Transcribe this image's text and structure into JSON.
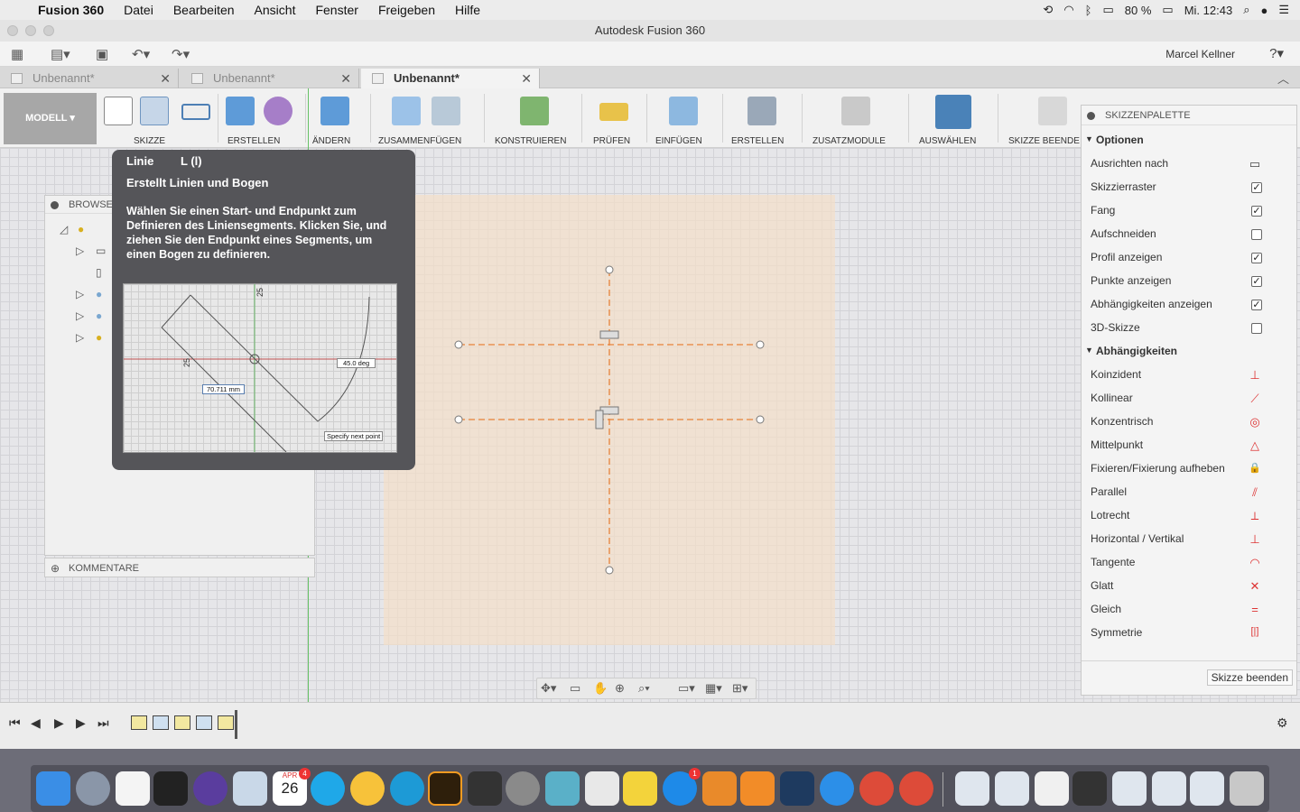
{
  "menubar": {
    "app_name": "Fusion 360",
    "items": [
      "Datei",
      "Bearbeiten",
      "Ansicht",
      "Fenster",
      "Freigeben",
      "Hilfe"
    ],
    "battery": "80 %",
    "clock": "Mi. 12:43"
  },
  "window": {
    "title": "Autodesk Fusion 360",
    "user": "Marcel Kellner"
  },
  "tabs": [
    {
      "label": "Unbenannt*",
      "active": false
    },
    {
      "label": "Unbenannt*",
      "active": false
    },
    {
      "label": "Unbenannt*",
      "active": true
    }
  ],
  "ribbon": {
    "workspace": "MODELL",
    "groups": [
      "SKIZZE",
      "ERSTELLEN",
      "ÄNDERN",
      "ZUSAMMENFÜGEN",
      "KONSTRUIEREN",
      "PRÜFEN",
      "EINFÜGEN",
      "ERSTELLEN",
      "ZUSATZMODULE",
      "AUSWÄHLEN",
      "SKIZZE BEENDE"
    ]
  },
  "browser": {
    "title": "BROWSER",
    "comments": "KOMMENTARE"
  },
  "tooltip": {
    "title": "Linie",
    "shortcut": "L (l)",
    "subtitle": "Erstellt Linien und Bogen",
    "description": "Wählen Sie einen Start- und Endpunkt zum Definieren des Liniensegments. Klicken Sie, und ziehen Sie den Endpunkt eines Segments, um einen Bogen zu definieren.",
    "preview": {
      "length": "70.711 mm",
      "angle": "45.0 deg",
      "hint": "Specify next point",
      "dim_a": "25",
      "dim_b": "25"
    }
  },
  "palette": {
    "title": "SKIZZENPALETTE",
    "options_label": "Optionen",
    "options": [
      {
        "label": "Ausrichten nach",
        "type": "icon"
      },
      {
        "label": "Skizzierraster",
        "checked": true
      },
      {
        "label": "Fang",
        "checked": true
      },
      {
        "label": "Aufschneiden",
        "checked": false
      },
      {
        "label": "Profil anzeigen",
        "checked": true
      },
      {
        "label": "Punkte anzeigen",
        "checked": true
      },
      {
        "label": "Abhängigkeiten anzeigen",
        "checked": true
      },
      {
        "label": "3D-Skizze",
        "checked": false
      }
    ],
    "constraints_label": "Abhängigkeiten",
    "constraints": [
      {
        "label": "Koinzident",
        "icon": "coincident-icon",
        "glyph": "⊥"
      },
      {
        "label": "Kollinear",
        "icon": "collinear-icon",
        "glyph": "⟋"
      },
      {
        "label": "Konzentrisch",
        "icon": "concentric-icon",
        "glyph": "◎"
      },
      {
        "label": "Mittelpunkt",
        "icon": "midpoint-icon",
        "glyph": "△"
      },
      {
        "label": "Fixieren/Fixierung aufheben",
        "icon": "lock-icon",
        "glyph": "🔒"
      },
      {
        "label": "Parallel",
        "icon": "parallel-icon",
        "glyph": "⫽"
      },
      {
        "label": "Lotrecht",
        "icon": "perpendicular-icon",
        "glyph": "⟂"
      },
      {
        "label": "Horizontal / Vertikal",
        "icon": "horizontal-vertical-icon",
        "glyph": "⊥"
      },
      {
        "label": "Tangente",
        "icon": "tangent-icon",
        "glyph": "◠"
      },
      {
        "label": "Glatt",
        "icon": "smooth-icon",
        "glyph": "✕"
      },
      {
        "label": "Gleich",
        "icon": "equal-icon",
        "glyph": "="
      },
      {
        "label": "Symmetrie",
        "icon": "symmetry-icon",
        "glyph": "[|]"
      }
    ],
    "finish_button": "Skizze beenden"
  },
  "dock": {
    "calendar_month": "APR",
    "calendar_day": "26",
    "calendar_badge": "4",
    "appstore_badge": "1"
  },
  "colors": {
    "sketch_line": "#e8823a",
    "sketch_fill": "#f6dec6",
    "accent_select": "#4a82b8"
  }
}
